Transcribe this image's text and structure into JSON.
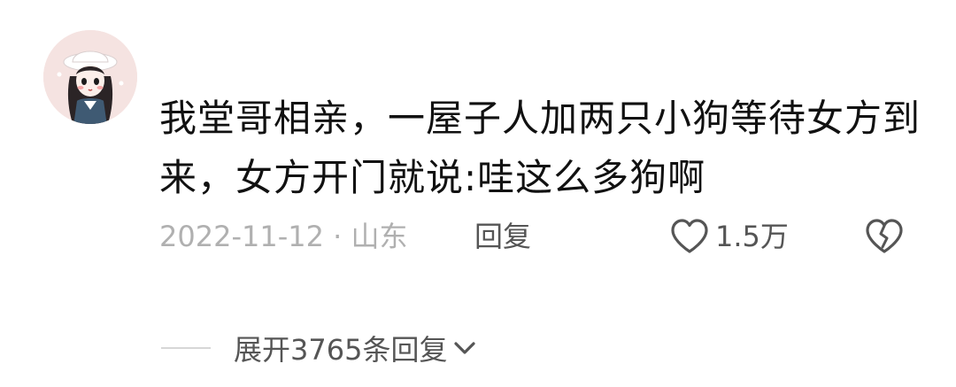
{
  "comment": {
    "text": "我堂哥相亲，一屋子人加两只小狗等待女方到来，女方开门就说:哇这么多狗啊",
    "date_location": "2022-11-12 · 山东",
    "reply_label": "回复",
    "like_count": "1.5万"
  },
  "replies": {
    "expand_label": "展开3765条回复"
  },
  "icons": {
    "like": "heart-outline-icon",
    "dislike": "broken-heart-icon",
    "expand": "chevron-down-icon"
  },
  "colors": {
    "text_primary": "#111111",
    "text_secondary": "#555555",
    "text_muted": "#b0b0b0"
  }
}
